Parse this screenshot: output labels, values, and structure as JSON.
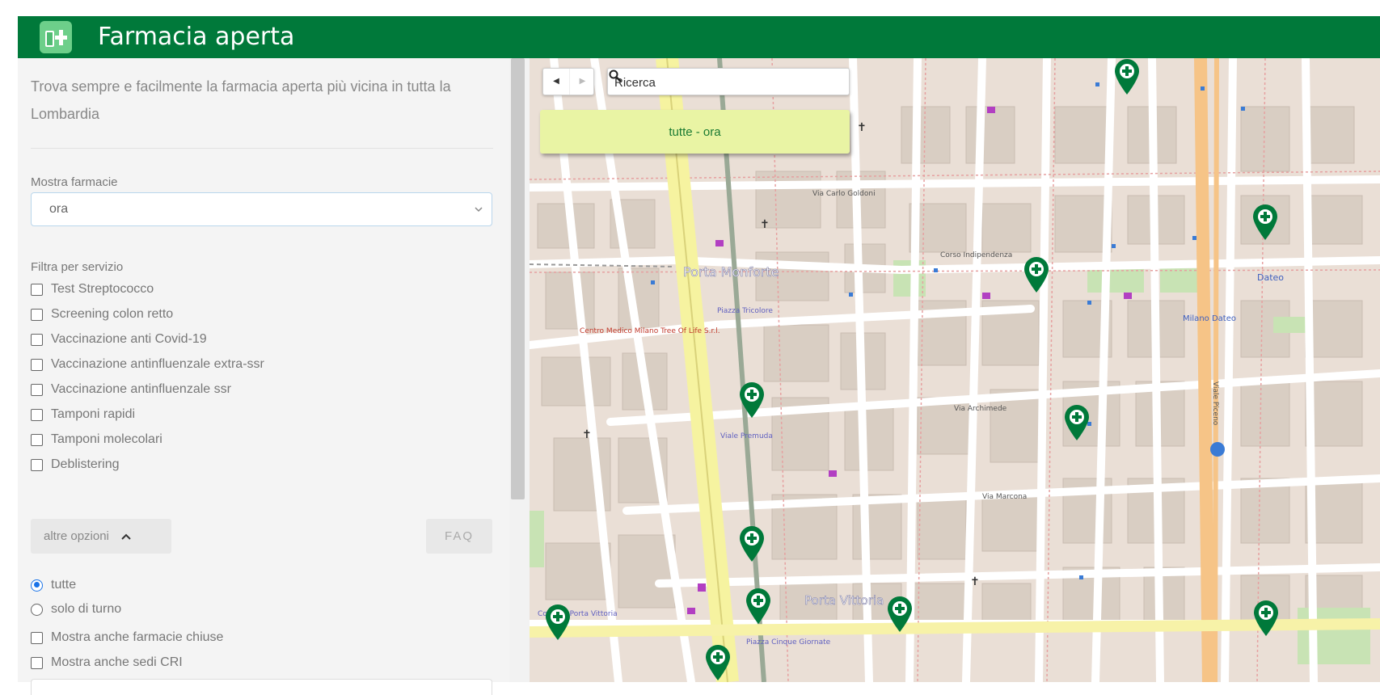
{
  "header": {
    "title": "Farmacia aperta"
  },
  "sidebar": {
    "intro": "Trova sempre e facilmente la farmacia aperta più vicina in tutta la Lombardia",
    "show_label": "Mostra farmacie",
    "show_select_value": "ora",
    "filter_label": "Filtra per servizio",
    "services": [
      "Test Streptococco",
      "Screening colon retto",
      "Vaccinazione anti Covid-19",
      "Vaccinazione antinfluenzale extra-ssr",
      "Vaccinazione antinfluenzale ssr",
      "Tamponi rapidi",
      "Tamponi molecolari",
      "Deblistering"
    ],
    "more_options_label": "altre opzioni",
    "faq_label": "FAQ",
    "radio_options": [
      "tutte",
      "solo di turno"
    ],
    "radio_selected": "tutte",
    "extra_checks": [
      "Mostra anche farmacie chiuse",
      "Mostra anche sedi CRI"
    ]
  },
  "map": {
    "search_placeholder": "Ricerca",
    "status_banner": "tutte - ora",
    "place_labels": [
      "Porta Monforte",
      "Porta Vittoria",
      "Centro Medico Milano Tree Of Life S.r.l.",
      "Piazza Tricolore",
      "Viale Premuda",
      "Via Archimede",
      "Via Marcona",
      "Via Carlo Goldoni",
      "Corso Indipendenza",
      "Dateo",
      "Milano Dateo",
      "Viale Piceno",
      "Corso di Porta Vittoria",
      "Piazza Cinque Giornate"
    ]
  },
  "colors": {
    "header_green": "#00793a",
    "pin_green": "#00793a",
    "banner": "#e9f4a4",
    "radio_accent": "#1a73e8"
  }
}
